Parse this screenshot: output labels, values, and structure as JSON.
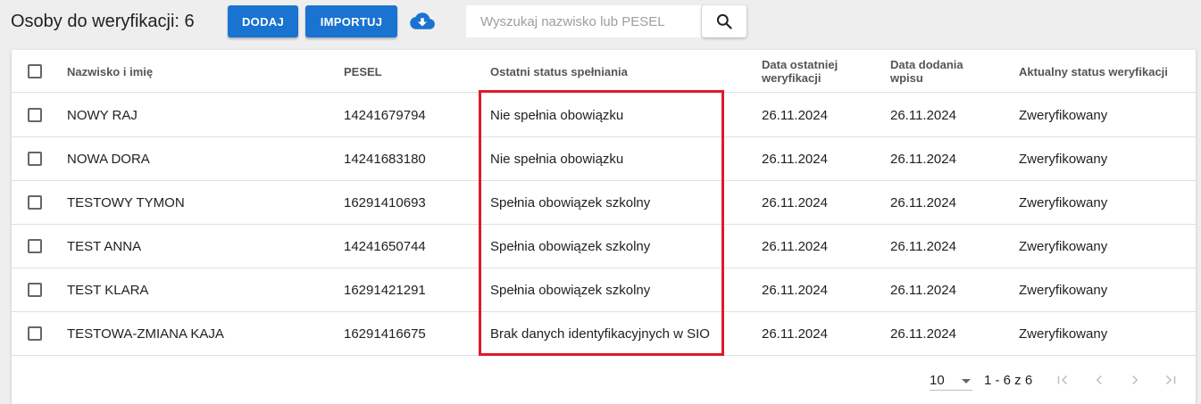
{
  "toolbar": {
    "title": "Osoby do weryfikacji: 6",
    "add_label": "DODAJ",
    "import_label": "IMPORTUJ",
    "download_icon": "cloud-download-icon",
    "search_placeholder": "Wyszukaj nazwisko lub PESEL",
    "search_value": "",
    "search_icon": "search-icon"
  },
  "colors": {
    "primary": "#1a73d0",
    "highlight": "#e0192a",
    "background": "#eeeeee"
  },
  "table": {
    "headers": {
      "name": "Nazwisko i imię",
      "pesel": "PESEL",
      "status": "Ostatni status spełniania",
      "date1_line1": "Data ostatniej",
      "date1_line2": "weryfikacji",
      "date2_line1": "Data dodania",
      "date2_line2": "wpisu",
      "verification": "Aktualny status weryfikacji"
    },
    "rows": [
      {
        "name": "NOWY RAJ",
        "pesel": "14241679794",
        "status": "Nie spełnia obowiązku",
        "date1": "26.11.2024",
        "date2": "26.11.2024",
        "verification": "Zweryfikowany"
      },
      {
        "name": "NOWA DORA",
        "pesel": "14241683180",
        "status": "Nie spełnia obowiązku",
        "date1": "26.11.2024",
        "date2": "26.11.2024",
        "verification": "Zweryfikowany"
      },
      {
        "name": "TESTOWY TYMON",
        "pesel": "16291410693",
        "status": "Spełnia obowiązek szkolny",
        "date1": "26.11.2024",
        "date2": "26.11.2024",
        "verification": "Zweryfikowany"
      },
      {
        "name": "TEST ANNA",
        "pesel": "14241650744",
        "status": "Spełnia obowiązek szkolny",
        "date1": "26.11.2024",
        "date2": "26.11.2024",
        "verification": "Zweryfikowany"
      },
      {
        "name": "TEST KLARA",
        "pesel": "16291421291",
        "status": "Spełnia obowiązek szkolny",
        "date1": "26.11.2024",
        "date2": "26.11.2024",
        "verification": "Zweryfikowany"
      },
      {
        "name": "TESTOWA-ZMIANA KAJA",
        "pesel": "16291416675",
        "status": "Brak danych identyfikacyjnych w SIO",
        "date1": "26.11.2024",
        "date2": "26.11.2024",
        "verification": "Zweryfikowany"
      }
    ]
  },
  "paginator": {
    "page_size": "10",
    "range_label": "1 - 6 z 6",
    "first_icon": "first-page-icon",
    "prev_icon": "chevron-left-icon",
    "next_icon": "chevron-right-icon",
    "last_icon": "last-page-icon"
  }
}
